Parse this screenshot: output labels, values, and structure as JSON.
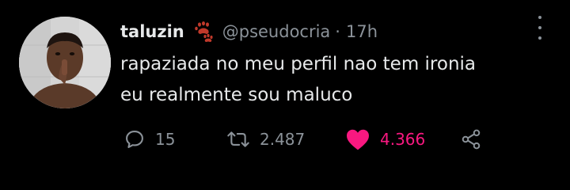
{
  "tweet": {
    "display_name": "taluzin",
    "handle": "@pseudocria",
    "separator": "·",
    "time": "17h",
    "text_lines": [
      "rapaziada no meu perfil nao tem ironia",
      "eu realmente sou maluco"
    ]
  },
  "actions": {
    "replies": "15",
    "retweets": "2.487",
    "likes": "4.366",
    "liked": true
  },
  "colors": {
    "background": "#000000",
    "text": "#e7e9ea",
    "muted": "#8b9299",
    "like": "#f91880",
    "paw_badge": "#c0392b"
  },
  "icons": {
    "badge": "paw-prints-icon",
    "reply": "speech-bubble-icon",
    "retweet": "retweet-arrows-icon",
    "like": "heart-filled-icon",
    "share": "share-nodes-icon",
    "more": "vertical-ellipsis-icon"
  }
}
